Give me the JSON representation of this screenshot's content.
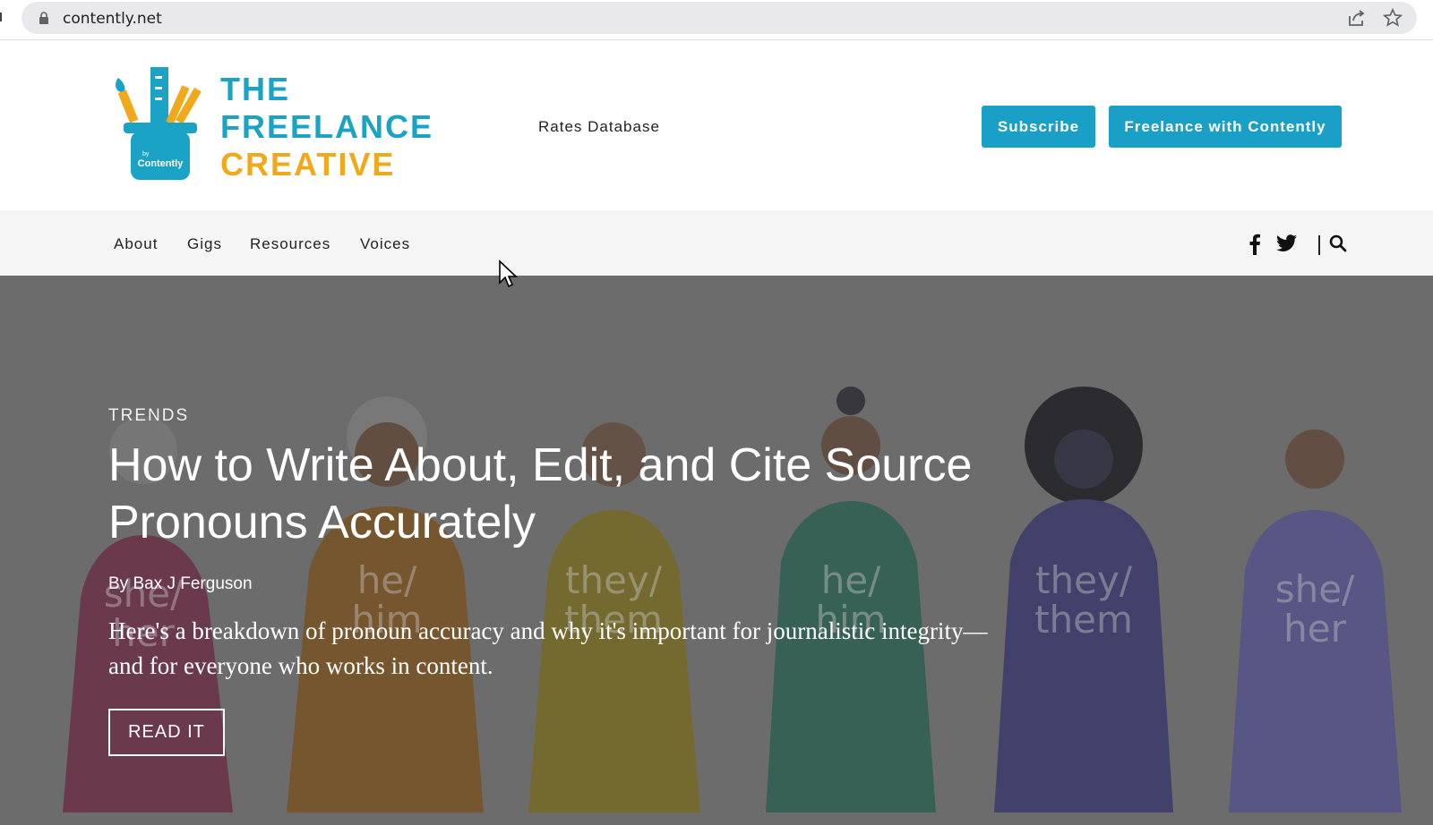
{
  "browser": {
    "url": "contently.net",
    "icons": [
      "lock-icon",
      "share-icon",
      "star-icon"
    ]
  },
  "header": {
    "logo": {
      "line_1": "THE",
      "line_2": "FREELANCE",
      "line_3": "CREATIVE",
      "badge": "by Contently"
    },
    "rates_link": "Rates Database",
    "subscribe_label": "Subscribe",
    "freelance_label": "Freelance with Contently"
  },
  "nav": {
    "items": [
      {
        "label": "About"
      },
      {
        "label": "Gigs"
      },
      {
        "label": "Resources"
      },
      {
        "label": "Voices"
      }
    ],
    "icons": [
      "facebook-icon",
      "twitter-icon",
      "search-icon"
    ]
  },
  "hero": {
    "category": "TRENDS",
    "headline": "How to Write About, Edit, and Cite Source Pronouns Accurately",
    "byline": "By Bax J Ferguson",
    "excerpt": "Here's a breakdown of pronoun accuracy and why it's important for journalistic integrity—and for everyone who works in content.",
    "cta_label": "READ IT",
    "shirt_texts": [
      "she/her",
      "he/him",
      "they/them",
      "he/him",
      "they/them",
      "she/her"
    ]
  },
  "colors": {
    "brand_blue": "#1aa0c7",
    "brand_yellow": "#f0a91c",
    "nav_bg": "#f5f5f5",
    "hero_bg": "#7a7a7a"
  }
}
